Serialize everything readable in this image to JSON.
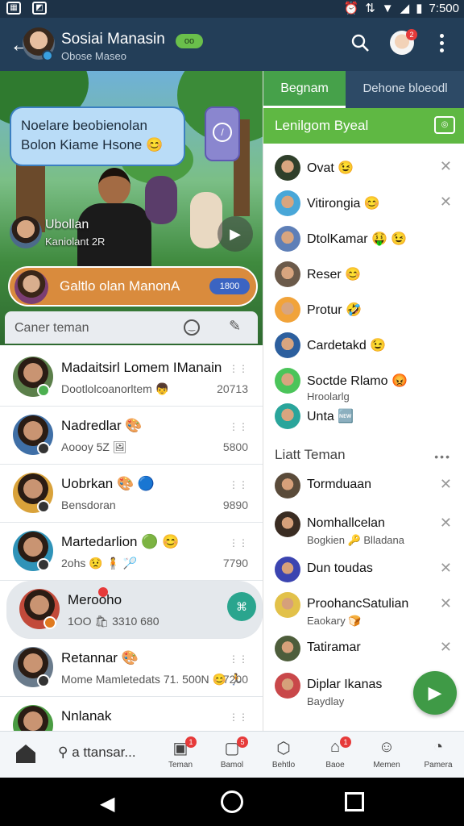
{
  "status": {
    "time": "7:500"
  },
  "appbar": {
    "title": "Sosiai Manasin",
    "subtitle": "Obose Maseo",
    "badge": "oo",
    "notif_count": "2"
  },
  "hero": {
    "bubble_text": "Noelare beobienolan Bolon Kiame Hsone 😊",
    "top_pill": "",
    "caption_name": "Ubollan",
    "caption_sub": "Kaniolant 2R",
    "orange_label": "Galtlo olan ManonA",
    "orange_pill": "1800",
    "search_placeholder": "Caner teman"
  },
  "left_list": [
    {
      "name": "Madaitsirl Lomem IManain",
      "msg": "Dootlolcoanorltem 👦",
      "time": "20713",
      "status_color": "#4caf50"
    },
    {
      "name": "Nadredlar 🎨",
      "msg": "Aoooy 5Z 🖼",
      "time": "5800",
      "status_color": "#333"
    },
    {
      "name": "Uobrkan 🎨 🔵",
      "msg": "Bensdoran",
      "time": "9890",
      "status_color": "#333"
    },
    {
      "name": "Martedarlion 🟢 😊",
      "msg": "2ohs 😟 🧍 🏸",
      "time": "7790",
      "status_color": "#333"
    },
    {
      "name": "Merooho",
      "msg": "1OO 🛍 3310 680",
      "time": "",
      "status_color": "#e07a1f",
      "selected": true
    },
    {
      "name": "Retannar 🎨",
      "msg": "Mome Mamletedats 71. 500N 😊 🏃",
      "time": "7200",
      "status_color": "#333"
    },
    {
      "name": "Nnlanak",
      "msg": "",
      "time": "",
      "status_color": "#4caf50"
    }
  ],
  "right_panel": {
    "tab_active": "Begnam",
    "tab_other": "Dehone bloeodl",
    "green_bar": "Lenilgom Byeal",
    "online": [
      {
        "name": "Ovat 😉"
      },
      {
        "name": "Vitirongia 😊"
      },
      {
        "name": "DtolKamar 🤑 😉"
      },
      {
        "name": "Reser 😊"
      },
      {
        "name": "Protur 🤣"
      },
      {
        "name": "Cardetakd 😉"
      },
      {
        "name": "Soctde Rlamo 😡",
        "sub": "Hroolarlg"
      },
      {
        "name": "Unta 🆕"
      }
    ],
    "section_title": "Liatt Teman",
    "list": [
      {
        "name": "Tormduaan"
      },
      {
        "name": "Nomhallcelan",
        "sub": "Bogkien 🔑 Blladana"
      },
      {
        "name": "Dun toudas"
      },
      {
        "name": "ProohancSatulian",
        "sub": "Eaokary 🍞"
      },
      {
        "name": "Tatiramar"
      },
      {
        "name": "Diplar Ikanas",
        "sub": "Baydlay"
      }
    ]
  },
  "bottom_nav": {
    "search_label": "a ttansar...",
    "items": [
      {
        "label": "Teman",
        "badge": "1"
      },
      {
        "label": "Bamol",
        "badge": "5"
      },
      {
        "label": "Behtlo",
        "badge": ""
      },
      {
        "label": "Baoe",
        "badge": "1"
      },
      {
        "label": "Memen",
        "badge": ""
      },
      {
        "label": "Pamera",
        "badge": ""
      }
    ]
  }
}
